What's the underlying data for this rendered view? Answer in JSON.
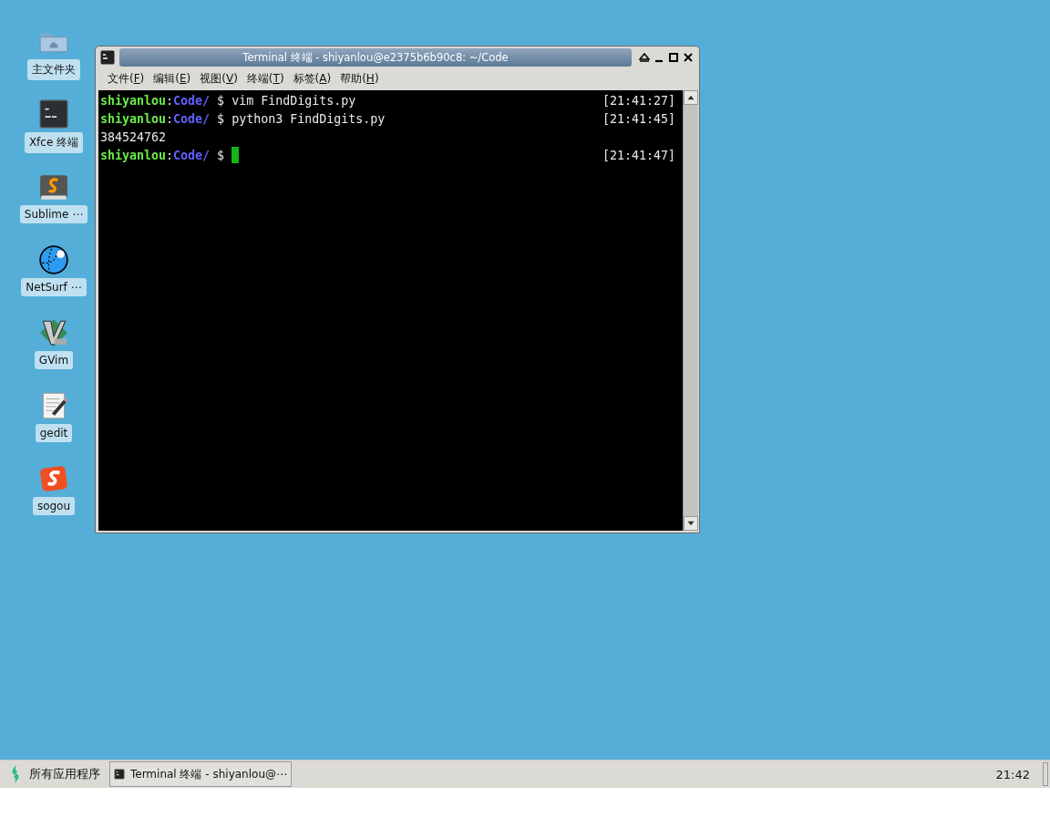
{
  "desktop_icons": [
    {
      "kind": "folder",
      "label": "主文件夹"
    },
    {
      "kind": "terminal",
      "label": "Xfce 终端"
    },
    {
      "kind": "sublime",
      "label": "Sublime ⋯"
    },
    {
      "kind": "netsurf",
      "label": "NetSurf ⋯"
    },
    {
      "kind": "gvim",
      "label": "GVim"
    },
    {
      "kind": "gedit",
      "label": "gedit"
    },
    {
      "kind": "sogou",
      "label": "sogou"
    }
  ],
  "window": {
    "title": "Terminal 终端 - shiyanlou@e2375b6b90c8: ~/Code",
    "menu": [
      {
        "parts": [
          "文件(",
          "F",
          ")"
        ]
      },
      {
        "parts": [
          "编辑(",
          "E",
          ")"
        ]
      },
      {
        "parts": [
          "视图(",
          "V",
          ")"
        ]
      },
      {
        "parts": [
          "终端(",
          "T",
          ")"
        ]
      },
      {
        "parts": [
          "标签(",
          "A",
          ")"
        ]
      },
      {
        "parts": [
          "帮助(",
          "H",
          ")"
        ]
      }
    ],
    "lines": [
      {
        "kind": "prompt",
        "user": "shiyanlou",
        "sep": ":",
        "path": "Code/",
        "command": " $ vim FindDigits.py",
        "time": "[21:41:27]",
        "cursor": false
      },
      {
        "kind": "prompt",
        "user": "shiyanlou",
        "sep": ":",
        "path": "Code/",
        "command": " $ python3 FindDigits.py",
        "time": "[21:41:45]",
        "cursor": false
      },
      {
        "kind": "output",
        "text": "384524762"
      },
      {
        "kind": "prompt",
        "user": "shiyanlou",
        "sep": ":",
        "path": "Code/",
        "command": " $ ",
        "time": "[21:41:47]",
        "cursor": true
      }
    ]
  },
  "taskbar": {
    "start": "所有应用程序",
    "tasks": [
      {
        "label": "Terminal 终端 - shiyanlou@⋯",
        "selected": false
      }
    ],
    "clock": "21:42"
  }
}
